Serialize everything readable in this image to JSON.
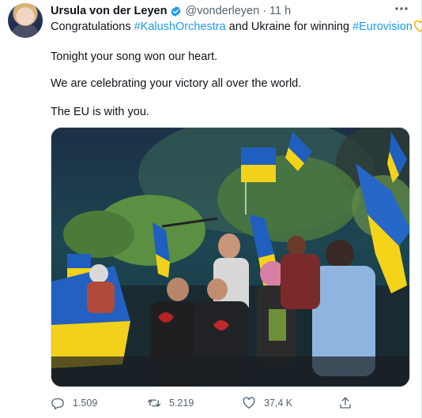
{
  "author": {
    "name": "Ursula von der Leyen",
    "handle": "@vonderleyen",
    "separator": "·",
    "time": "11 h"
  },
  "tweet": {
    "line1_prefix": "Congratulations ",
    "hashtag1": "#KalushOrchestra",
    "line1_middle": " and Ukraine for winning ",
    "hashtag2": "#Eurovision",
    "line2": "Tonight your song won our heart.",
    "line3": "We are celebrating your victory all over the world.",
    "line4": "The EU is with you."
  },
  "stats": {
    "replies": "1.509",
    "retweets": "5.219",
    "likes": "37,4 K"
  },
  "icons": {
    "verified": "verified-badge-icon",
    "more": "more-icon",
    "heart": "yellow-heart-icon",
    "reply": "reply-icon",
    "retweet": "retweet-icon",
    "like": "like-icon",
    "share": "share-icon"
  },
  "colors": {
    "link": "#1d9bf0",
    "text": "#0f1419",
    "secondary": "#536471",
    "verified": "#1d9bf0",
    "heart": "#f4b400"
  }
}
